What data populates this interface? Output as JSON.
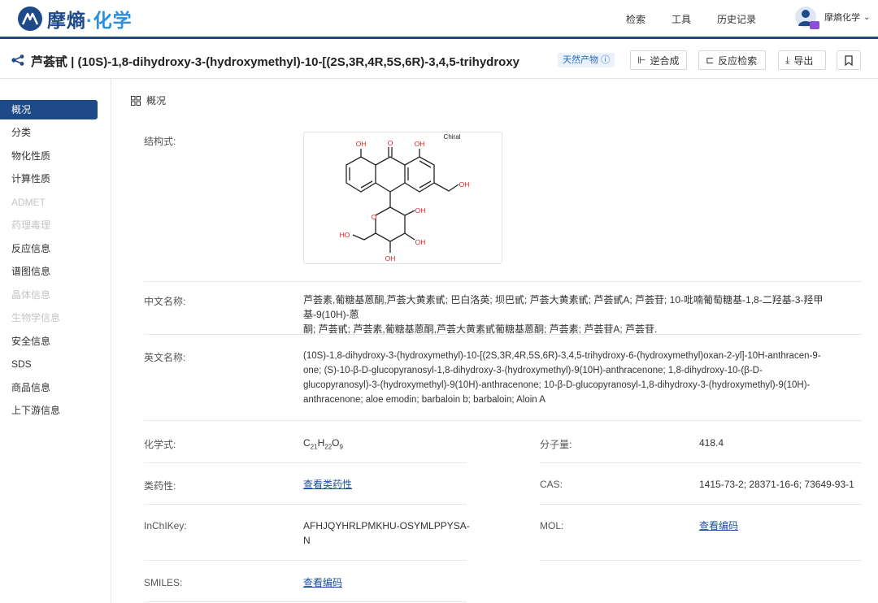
{
  "header": {
    "logo_text_a": "摩熵",
    "logo_dot": "·",
    "logo_text_b": "化学",
    "nav": [
      "检索",
      "工具",
      "历史记录"
    ],
    "user_name": "摩熵化学"
  },
  "titlebar": {
    "title": "芦荟甙 | (10S)-1,8-dihydroxy-3-(hydroxymethyl)-10-[(2S,3R,4R,5S,6R)-3,4,5-trihydroxy",
    "tag": "天然产物",
    "buttons": [
      "逆合成",
      "反应检索",
      "导出"
    ]
  },
  "sidebar": {
    "items": [
      {
        "label": "概况",
        "state": "active"
      },
      {
        "label": "分类",
        "state": "normal"
      },
      {
        "label": "物化性质",
        "state": "normal"
      },
      {
        "label": "计算性质",
        "state": "normal"
      },
      {
        "label": "ADMET",
        "state": "disabled"
      },
      {
        "label": "药理毒理",
        "state": "disabled"
      },
      {
        "label": "反应信息",
        "state": "normal"
      },
      {
        "label": "谱图信息",
        "state": "normal"
      },
      {
        "label": "晶体信息",
        "state": "disabled"
      },
      {
        "label": "生物学信息",
        "state": "disabled"
      },
      {
        "label": "安全信息",
        "state": "normal"
      },
      {
        "label": "SDS",
        "state": "normal"
      },
      {
        "label": "商品信息",
        "state": "normal"
      },
      {
        "label": "上下游信息",
        "state": "normal"
      }
    ]
  },
  "overview": {
    "section_title": "概况",
    "structure_label": "结构式:",
    "structure": {
      "chiral": "Chiral",
      "atoms": [
        "OH",
        "O",
        "OH",
        "OH",
        "O",
        "OH",
        "HO",
        "OH",
        "OH"
      ]
    },
    "cn_name_label": "中文名称:",
    "cn_name_line1": "芦荟素,葡糖基蒽酮,芦荟大黄素甙; 巴白洛英; 坝巴甙; 芦荟大黄素甙; 芦荟甙A; 芦荟苷; 10-吡喃葡萄糖基-1,8-二羟基-3-羟甲基-9(10H)-蒽",
    "cn_name_line2": "酮; 芦荟甙; 芦荟素,葡糖基蒽酮,芦荟大黄素甙葡糖基蒽酮; 芦荟素; 芦荟苷A; 芦荟苷.",
    "en_name_label": "英文名称:",
    "en_name_lines": [
      "(10S)-1,8-dihydroxy-3-(hydroxymethyl)-10-[(2S,3R,4R,5S,6R)-3,4,5-trihydroxy-6-(hydroxymethyl)oxan-2-yl]-10H-anthracen-9-",
      "one; (S)-10-β-D-glucopyranosyl-1,8-dihydroxy-3-(hydroxymethyl)-9(10H)-anthracenone; 1,8-dihydroxy-10-(β-D-",
      "glucopyranosyl)-3-(hydroxymethyl)-9(10H)-anthracenone; 10-β-D-glucopyranosyl-1,8-dihydroxy-3-(hydroxymethyl)-9(10H)-",
      "anthracenone; aloe emodin; barbaloin b; barbaloin; Aloin A"
    ],
    "formula_label": "化学式:",
    "formula": {
      "c": "C",
      "c_n": "21",
      "h": "H",
      "h_n": "22",
      "o": "O",
      "o_n": "9"
    },
    "mw_label": "分子量:",
    "mw": "418.4",
    "druglike_label": "类药性:",
    "druglike_link": "查看类药性",
    "cas_label": "CAS:",
    "cas": "1415-73-2; 28371-16-6; 73649-93-1",
    "inchikey_label": "InChIKey:",
    "inchikey_line1": "AFHJQYHRLPMKHU-OSYMLPPYSA-",
    "inchikey_line2": "N",
    "mol_label": "MOL:",
    "mol_link": "查看编码",
    "smiles_label": "SMILES:",
    "smiles_link": "查看编码"
  },
  "colors": {
    "brand": "#1f4a8a",
    "accent": "#2a8fe0",
    "link": "#1a4f9c",
    "oxygen": "#e02020"
  }
}
